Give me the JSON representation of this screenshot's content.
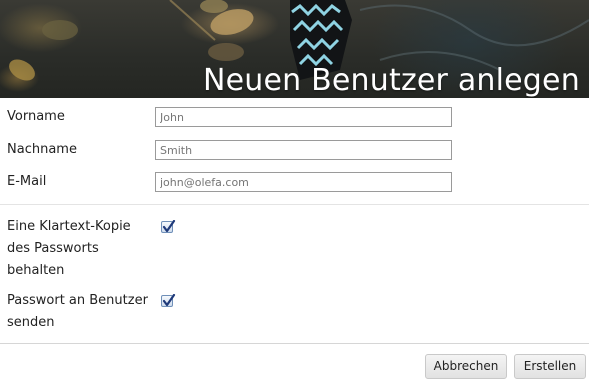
{
  "dialog": {
    "title": "Neuen Benutzer anlegen"
  },
  "form": {
    "first_name": {
      "label": "Vorname",
      "value": "John"
    },
    "last_name": {
      "label": "Nachname",
      "value": "Smith"
    },
    "email": {
      "label": "E-Mail",
      "placeholder": "john@olefa.com"
    },
    "keep_plaintext": {
      "label_lines": [
        "Eine Klartext-Kopie",
        "des Passworts",
        "behalten"
      ],
      "checked": true
    },
    "send_password": {
      "label_lines": [
        "Passwort an Benutzer",
        "senden"
      ],
      "checked": true
    }
  },
  "buttons": {
    "cancel": "Abbrechen",
    "create": "Erstellen"
  },
  "colors": {
    "checkmark": "#1f3a7a",
    "title_text": "#ffffff"
  }
}
